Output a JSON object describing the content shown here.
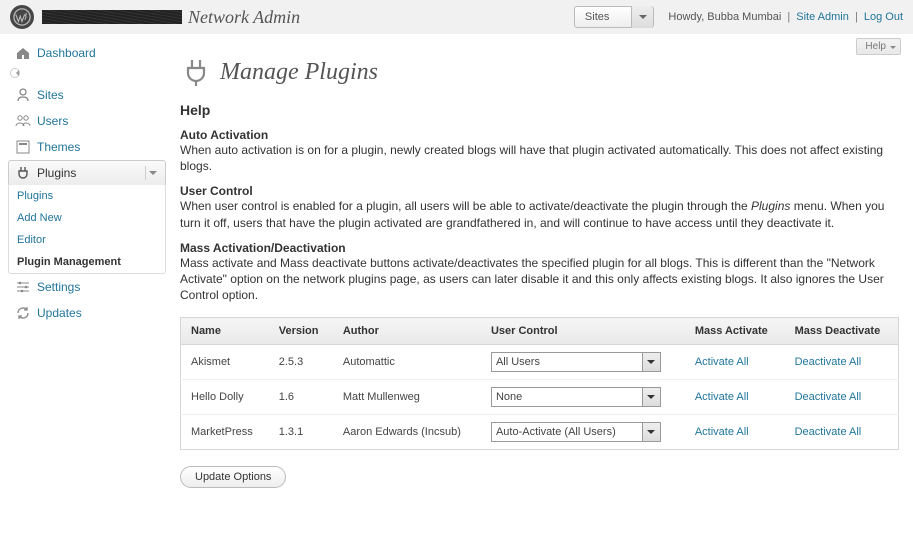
{
  "top": {
    "network_admin_label": "Network Admin",
    "sites_dropdown_label": "Sites",
    "howdy": "Howdy, Bubba Mumbai",
    "site_admin": "Site Admin",
    "logout": "Log Out",
    "help_tab": "Help"
  },
  "sidebar": {
    "dashboard": "Dashboard",
    "sites": "Sites",
    "users": "Users",
    "themes": "Themes",
    "plugins": "Plugins",
    "settings": "Settings",
    "updates": "Updates",
    "sub": {
      "plugins": "Plugins",
      "add_new": "Add New",
      "editor": "Editor",
      "plugin_management": "Plugin Management"
    }
  },
  "page": {
    "title": "Manage Plugins",
    "help_heading": "Help",
    "auto_activation_h": "Auto Activation",
    "auto_activation_p": "When auto activation is on for a plugin, newly created blogs will have that plugin activated automatically. This does not affect existing blogs.",
    "user_control_h": "User Control",
    "user_control_p1": "When user control is enabled for a plugin, all users will be able to activate/deactivate the plugin through the ",
    "user_control_em": "Plugins",
    "user_control_p2": " menu. When you turn it off, users that have the plugin activated are grandfathered in, and will continue to have access until they deactivate it.",
    "mass_h": "Mass Activation/Deactivation",
    "mass_p": "Mass activate and Mass deactivate buttons activate/deactivates the specified plugin for all blogs. This is different than the \"Network Activate\" option on the network plugins page, as users can later disable it and this only affects existing blogs. It also ignores the User Control option.",
    "update_button": "Update Options"
  },
  "table": {
    "headers": {
      "name": "Name",
      "version": "Version",
      "author": "Author",
      "user_control": "User Control",
      "mass_activate": "Mass Activate",
      "mass_deactivate": "Mass Deactivate"
    },
    "rows": [
      {
        "name": "Akismet",
        "version": "2.5.3",
        "author": "Automattic",
        "uc": "All Users",
        "act": "Activate All",
        "deact": "Deactivate All"
      },
      {
        "name": "Hello Dolly",
        "version": "1.6",
        "author": "Matt Mullenweg",
        "uc": "None",
        "act": "Activate All",
        "deact": "Deactivate All"
      },
      {
        "name": "MarketPress",
        "version": "1.3.1",
        "author": "Aaron Edwards (Incsub)",
        "uc": "Auto-Activate (All Users)",
        "act": "Activate All",
        "deact": "Deactivate All"
      }
    ]
  }
}
